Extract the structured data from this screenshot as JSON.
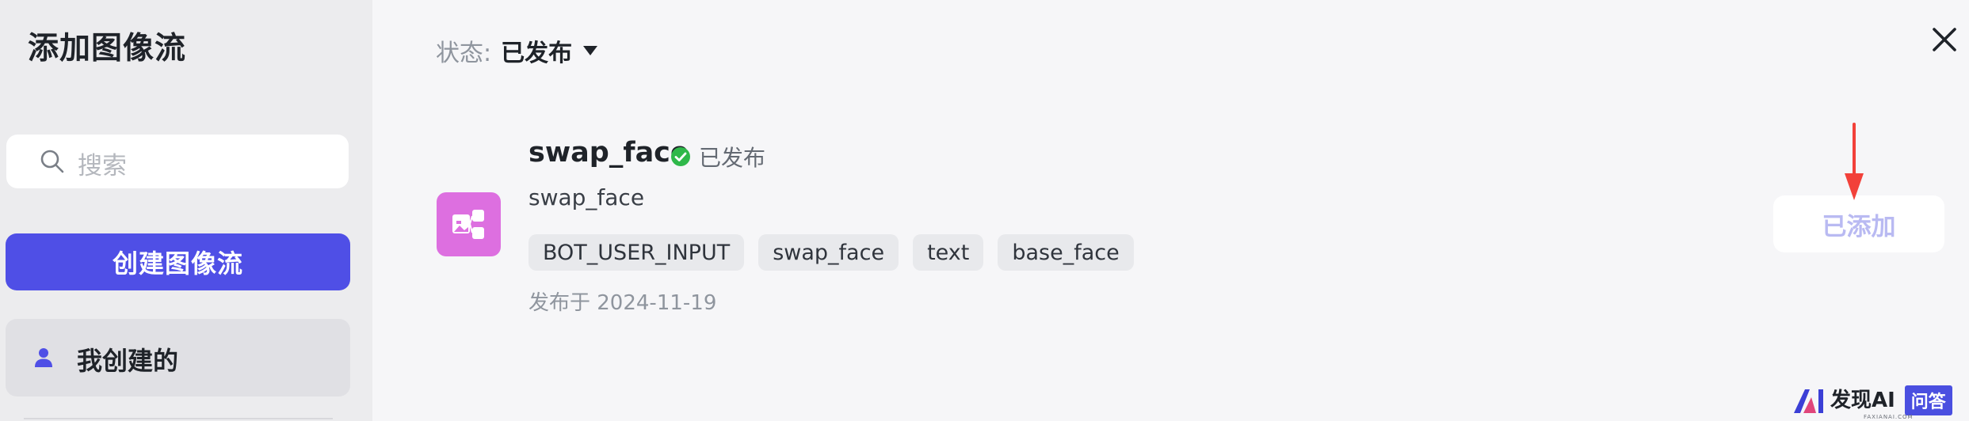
{
  "sidebar": {
    "title": "添加图像流",
    "search_placeholder": "搜索",
    "create_button_label": "创建图像流",
    "mine_label": "我创建的"
  },
  "header": {
    "status_label": "状态:",
    "status_value": "已发布"
  },
  "flow": {
    "title": "swap_face",
    "status": "已发布",
    "description": "swap_face",
    "tags": [
      "BOT_USER_INPUT",
      "swap_face",
      "text",
      "base_face"
    ],
    "published_date": "发布于 2024-11-19",
    "action_label": "已添加"
  },
  "watermark": {
    "brand": "发现AI",
    "subtitle": "FAXIANAI.COM",
    "badge": "问答"
  },
  "colors": {
    "accent": "#4f4fe6",
    "flow_icon_bg": "#dd6fe0",
    "success": "#2fb84a",
    "annotation_arrow": "#f2413a"
  }
}
